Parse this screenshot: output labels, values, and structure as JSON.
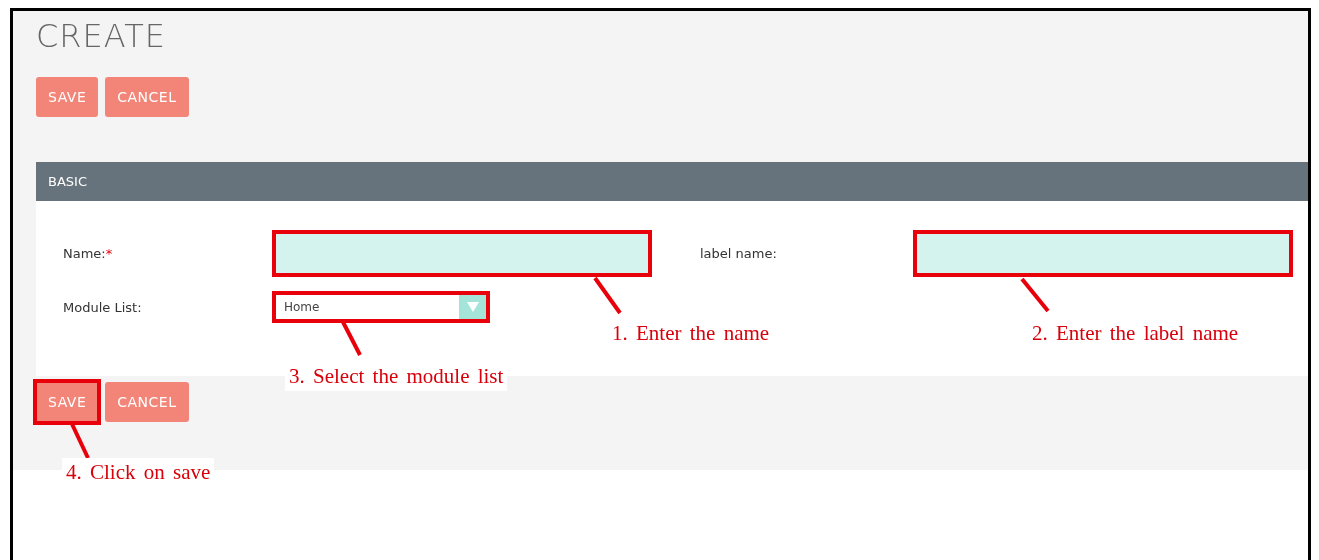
{
  "page_title": "CREATE",
  "top_buttons": [
    {
      "label": "SAVE",
      "highlighted": false
    },
    {
      "label": "CANCEL",
      "highlighted": false
    }
  ],
  "section": {
    "title": "BASIC"
  },
  "fields": [
    {
      "kind": "text",
      "label": "Name:",
      "required_mark": "*",
      "highlighted": true
    },
    {
      "kind": "text",
      "label": "label name:",
      "highlighted": true
    },
    {
      "kind": "select",
      "label": "Module List:",
      "value": "Home",
      "highlighted": true
    }
  ],
  "bottom_buttons": [
    {
      "label": "SAVE",
      "highlighted": true
    },
    {
      "label": "CANCEL",
      "highlighted": false
    }
  ],
  "annotations": [
    {
      "text": "1. Enter the name"
    },
    {
      "text": "2. Enter the label name"
    },
    {
      "text": "3. Select the module list"
    },
    {
      "text": "4. Click on save"
    }
  ]
}
